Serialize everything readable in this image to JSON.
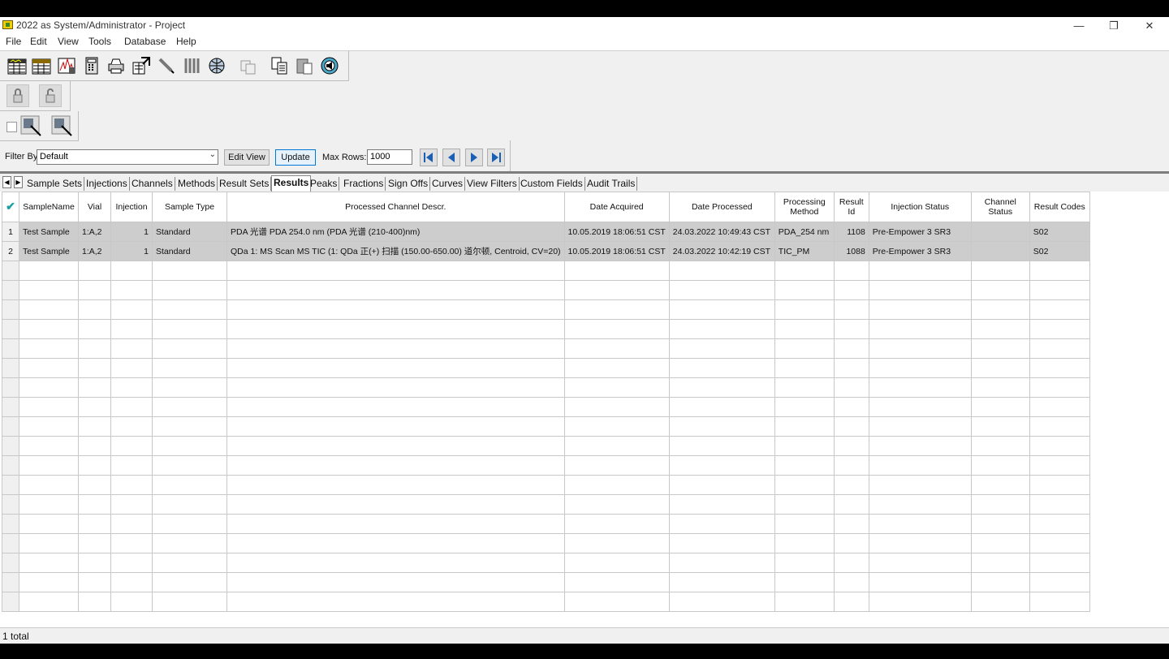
{
  "window": {
    "title": "2022 as System/Administrator - Project"
  },
  "menu": [
    "File",
    "Edit",
    "View",
    "Tools",
    "Database",
    "Help"
  ],
  "filter": {
    "label": "Filter By:",
    "value": "Default",
    "edit_view_label": "Edit View",
    "update_label": "Update",
    "max_rows_label": "Max Rows:",
    "max_rows_value": "1000"
  },
  "tabs": [
    "Sample Sets",
    "Injections",
    "Channels",
    "Methods",
    "Result Sets",
    "Results",
    "Peaks",
    "Fractions",
    "Sign Offs",
    "Curves",
    "View Filters",
    "Custom Fields",
    "Audit Trails"
  ],
  "active_tab": "Results",
  "table": {
    "columns": [
      "SampleName",
      "Vial",
      "Injection",
      "Sample Type",
      "Processed Channel Descr.",
      "Date Acquired",
      "Date Processed",
      "Processing Method",
      "Result Id",
      "Injection Status",
      "Channel Status",
      "Result Codes"
    ],
    "rows": [
      {
        "num": "1",
        "sample_name": "Test Sample",
        "vial": "1:A,2",
        "injection": "1",
        "sample_type": "Standard",
        "channel_descr": "PDA 光谱 PDA 254.0 nm (PDA 光谱 (210-400)nm)",
        "date_acquired": "10.05.2019 18:06:51 CST",
        "date_processed": "24.03.2022 10:49:43 CST",
        "processing_method": "PDA_254 nm",
        "result_id": "1108",
        "injection_status": "Pre-Empower 3 SR3",
        "channel_status": "",
        "result_codes": "S02"
      },
      {
        "num": "2",
        "sample_name": "Test Sample",
        "vial": "1:A,2",
        "injection": "1",
        "sample_type": "Standard",
        "channel_descr": "QDa 1: MS Scan MS TIC (1: QDa 正(+) 扫描 (150.00-650.00) 道尔顿, Centroid, CV=20)",
        "date_acquired": "10.05.2019 18:06:51 CST",
        "date_processed": "24.03.2022 10:42:19 CST",
        "processing_method": "TIC_PM",
        "result_id": "1088",
        "injection_status": "Pre-Empower 3 SR3",
        "channel_status": "",
        "result_codes": "S02"
      }
    ]
  },
  "status": {
    "text": "1 total"
  }
}
